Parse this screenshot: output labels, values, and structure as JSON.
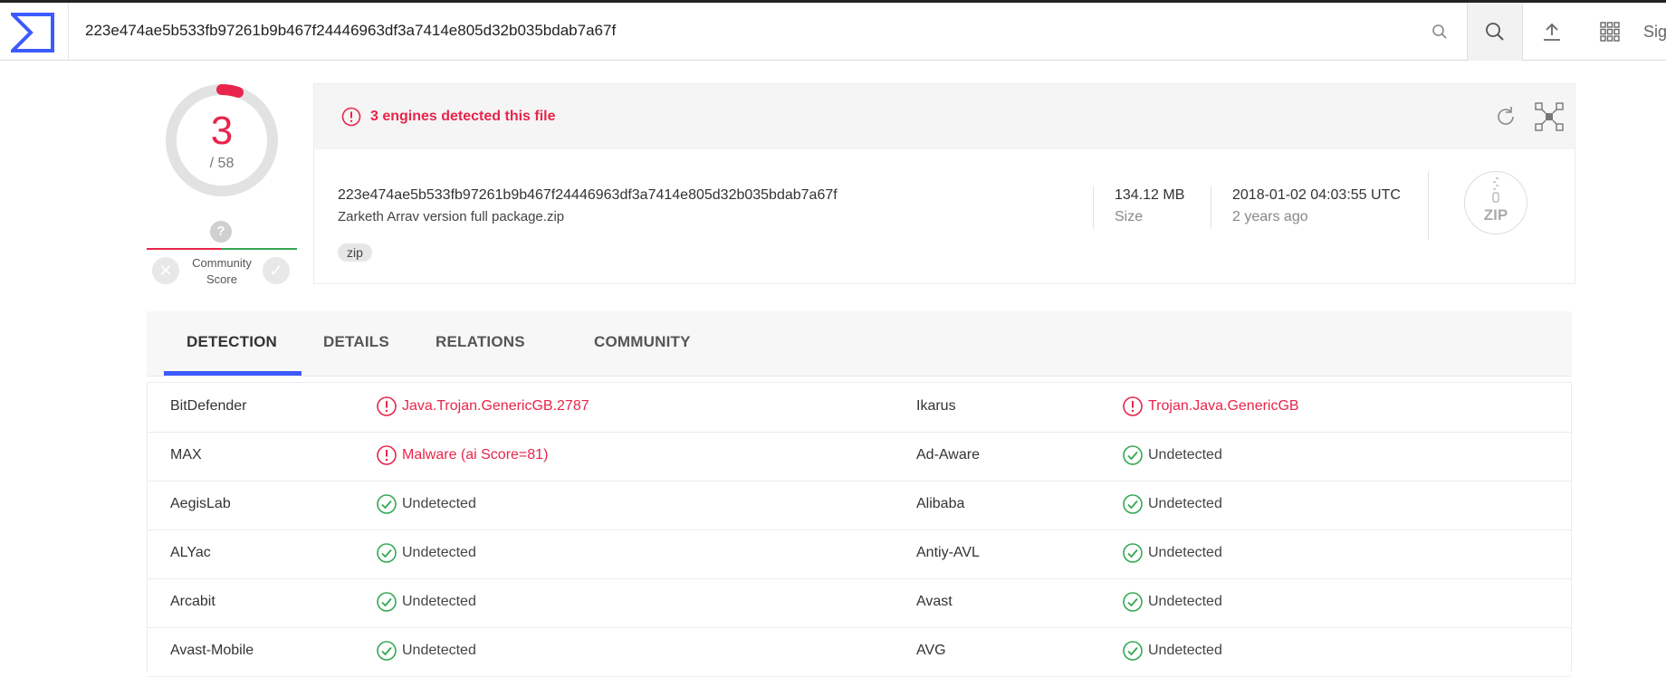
{
  "topbar": {
    "search_value": "223e474ae5b533fb97261b9b467f24446963df3a7414e805d32b035bdab7a67f",
    "signin_label": "Sig"
  },
  "score": {
    "detected": "3",
    "total": "/ 58"
  },
  "community": {
    "question_mark": "?",
    "label": "Community Score"
  },
  "summary": {
    "alert_text": "3 engines detected this file",
    "hash": "223e474ae5b533fb97261b9b467f24446963df3a7414e805d32b035bdab7a67f",
    "filename": "Zarketh Arrav version full package.zip",
    "tag": "zip",
    "size_value": "134.12 MB",
    "size_label": "Size",
    "date_value": "2018-01-02 04:03:55 UTC",
    "date_ago": "2 years ago",
    "file_type_icon": "ZIP"
  },
  "tabs": [
    "DETECTION",
    "DETAILS",
    "RELATIONS",
    "COMMUNITY"
  ],
  "results": [
    {
      "left": {
        "engine": "BitDefender",
        "verdict": "Java.Trojan.GenericGB.2787",
        "status": "malicious"
      },
      "right": {
        "engine": "Ikarus",
        "verdict": "Trojan.Java.GenericGB",
        "status": "malicious"
      }
    },
    {
      "left": {
        "engine": "MAX",
        "verdict": "Malware (ai Score=81)",
        "status": "malicious"
      },
      "right": {
        "engine": "Ad-Aware",
        "verdict": "Undetected",
        "status": "clean"
      }
    },
    {
      "left": {
        "engine": "AegisLab",
        "verdict": "Undetected",
        "status": "clean"
      },
      "right": {
        "engine": "Alibaba",
        "verdict": "Undetected",
        "status": "clean"
      }
    },
    {
      "left": {
        "engine": "ALYac",
        "verdict": "Undetected",
        "status": "clean"
      },
      "right": {
        "engine": "Antiy-AVL",
        "verdict": "Undetected",
        "status": "clean"
      }
    },
    {
      "left": {
        "engine": "Arcabit",
        "verdict": "Undetected",
        "status": "clean"
      },
      "right": {
        "engine": "Avast",
        "verdict": "Undetected",
        "status": "clean"
      }
    },
    {
      "left": {
        "engine": "Avast-Mobile",
        "verdict": "Undetected",
        "status": "clean"
      },
      "right": {
        "engine": "AVG",
        "verdict": "Undetected",
        "status": "clean"
      }
    }
  ],
  "colors": {
    "brand": "#3d5afe",
    "malicious": "#e8254a",
    "clean": "#34a853"
  }
}
